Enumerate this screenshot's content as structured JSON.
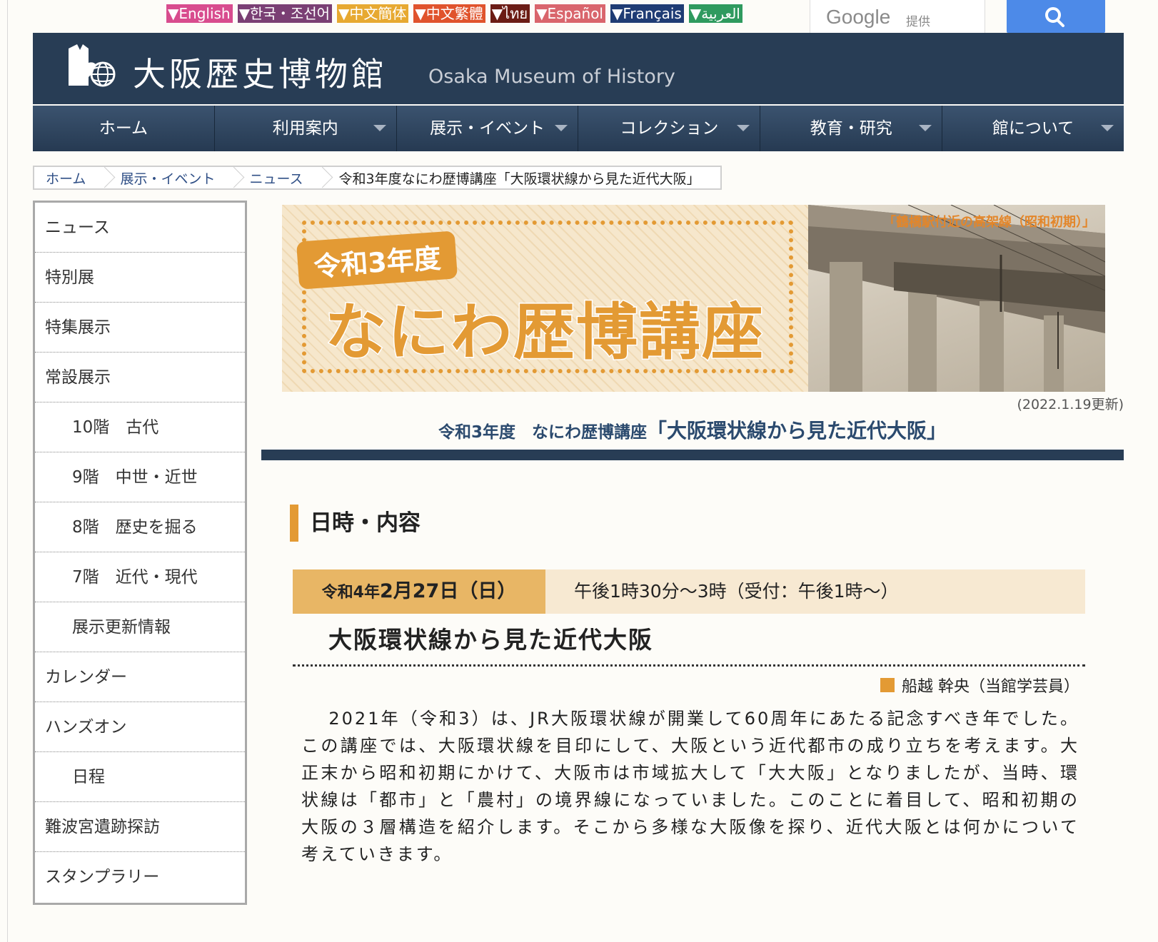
{
  "languages": [
    {
      "label": "▼English",
      "color": "#d84c8e"
    },
    {
      "label": "▼한국・조선어",
      "color": "#7a3f74"
    },
    {
      "label": "▼中文簡体",
      "color": "#e7a931"
    },
    {
      "label": "▼中文繁體",
      "color": "#e0532c"
    },
    {
      "label": "▼ไทย",
      "color": "#6b1c14"
    },
    {
      "label": "▼Español",
      "color": "#d9656c"
    },
    {
      "label": "▼Français",
      "color": "#1f3c74"
    },
    {
      "label": "▼العربية",
      "color": "#2f9a5f"
    }
  ],
  "search": {
    "provider": "Google",
    "provided_label": "提供",
    "icon": "search-icon",
    "button_color": "#4d8ae8"
  },
  "header": {
    "title": "大阪歴史博物館",
    "title_en": "Osaka Museum of History",
    "bg_color": "#283d55"
  },
  "nav": [
    {
      "label": "ホーム",
      "dropdown": false
    },
    {
      "label": "利用案内",
      "dropdown": true
    },
    {
      "label": "展示・イベント",
      "dropdown": true
    },
    {
      "label": "コレクション",
      "dropdown": true
    },
    {
      "label": "教育・研究",
      "dropdown": true
    },
    {
      "label": "館について",
      "dropdown": true
    }
  ],
  "breadcrumb": {
    "items": [
      "ホーム",
      "展示・イベント",
      "ニュース"
    ],
    "current": "令和3年度なにわ歴博講座「大阪環状線から見た近代大阪」"
  },
  "sidebar": [
    {
      "label": "ニュース",
      "sub": false
    },
    {
      "label": "特別展",
      "sub": false
    },
    {
      "label": "特集展示",
      "sub": false
    },
    {
      "label": "常設展示",
      "sub": false
    },
    {
      "label": "10階　古代",
      "sub": true
    },
    {
      "label": "9階　中世・近世",
      "sub": true
    },
    {
      "label": "8階　歴史を掘る",
      "sub": true
    },
    {
      "label": "7階　近代・現代",
      "sub": true
    },
    {
      "label": "展示更新情報",
      "sub": true
    },
    {
      "label": "カレンダー",
      "sub": false
    },
    {
      "label": "ハンズオン",
      "sub": false
    },
    {
      "label": "日程",
      "sub": true
    },
    {
      "label": "難波宮遺跡探訪",
      "sub": false
    },
    {
      "label": "スタンプラリー",
      "sub": false
    }
  ],
  "banner": {
    "year": "令和3年度",
    "title": "なにわ歴博講座",
    "photo_caption": "「鶴橋駅付近の高架線（昭和初期）」",
    "accent_color": "#e39a34"
  },
  "updated": "(2022.1.19更新)",
  "page_heading": {
    "prefix": "令和3年度　なにわ歴博講座",
    "title": "「大阪環状線から見た近代大阪」"
  },
  "section": {
    "title": "日時・内容"
  },
  "event": {
    "date_prefix": "令和4年",
    "date_main": "2月27日（日）",
    "time": "午後1時30分～3時（受付：午後1時～）",
    "lecture_title": "大阪環状線から見た近代大阪",
    "speaker": "船越 幹央（当館学芸員）",
    "description": "2021年（令和3）は、JR大阪環状線が開業して60周年にあたる記念すべき年でした。この講座では、大阪環状線を目印にして、大阪という近代都市の成り立ちを考えます。大正末から昭和初期にかけて、大阪市は市域拡大して「大大阪」となりましたが、当時、環状線は「都市」と「農村」の境界線になっていました。このことに着目して、昭和初期の大阪の３層構造を紹介します。そこから多様な大阪像を探り、近代大阪とは何かについて考えていきます。"
  }
}
